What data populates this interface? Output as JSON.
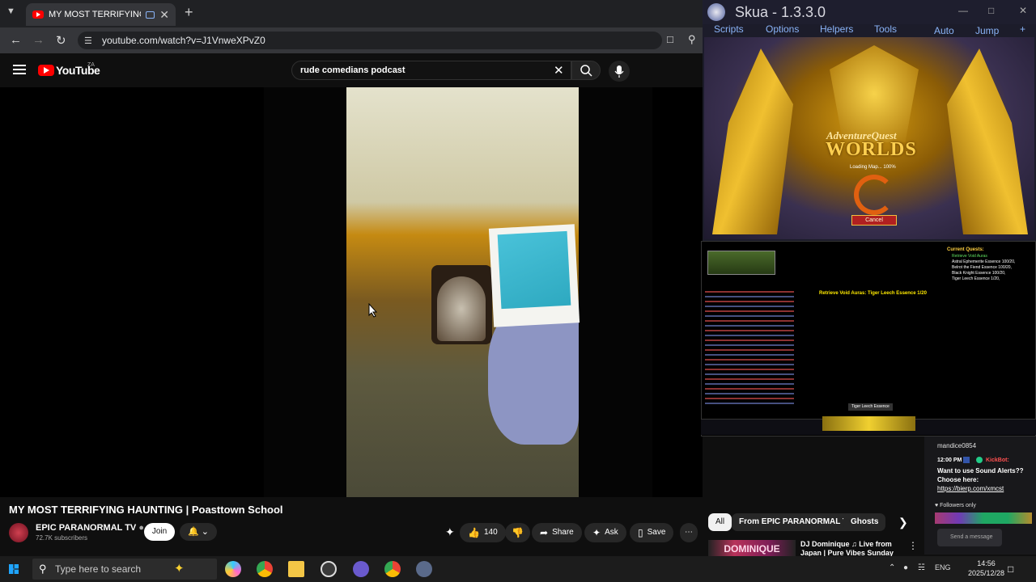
{
  "browser": {
    "tab_title": "MY MOST TERRIFYING HAUNT",
    "url": "youtube.com/watch?v=J1VnweXPvZ0"
  },
  "youtube": {
    "logo_text": "YouTube",
    "region": "ZA",
    "search_query": "rude comedians podcast",
    "video_title": "MY MOST TERRIFYING HAUNTING | Poasttown School",
    "channel_name": "EPIC PARANORMAL TV",
    "subscribers": "72.7K subscribers",
    "join_label": "Join",
    "like_count": "140",
    "share_label": "Share",
    "ask_label": "Ask",
    "save_label": "Save",
    "chips": [
      "All",
      "From EPIC PARANORMAL TV",
      "Ghosts"
    ],
    "rec_thumb_text": "DOMINIQUE",
    "rec_title": "DJ Dominique ♫ Live from Japan | Pure Vibes Sunday"
  },
  "skua": {
    "title": "Skua - 1.3.3.0",
    "menu": [
      "Scripts",
      "Options",
      "Helpers",
      "Tools"
    ],
    "menu_right": [
      "Auto",
      "Jump"
    ],
    "game_logo_top": "AdventureQuest",
    "game_logo": "WORLDS",
    "loading_text": "Loading Map... 100%",
    "cancel_label": "Cancel",
    "quest_title": "Current Quests:",
    "quest_lines": [
      "Retrieve Void Auras",
      "Astral Ephemerite Essence 100/20,",
      "Belrot the Fiend Essence 100/20,",
      "Black Knight Essence 100/20,",
      "Tiger Leech Essence 1/20,"
    ],
    "center_msg": "Retrieve Void Auras: Tiger Leech Essence 1/20",
    "tooltip": "Tiger Leech Essence"
  },
  "chat": {
    "user": "mandice0854",
    "time": "12:00 PM",
    "bot": "KickBot:",
    "lines": [
      "Want to use Sound Alerts??",
      "Choose here:"
    ],
    "link": "https://bierp.com/xmcst",
    "followers": "Followers only",
    "input_placeholder": "Send a message"
  },
  "taskbar": {
    "search_placeholder": "Type here to search",
    "lang": "ENG",
    "time": "14:56",
    "date": "2025/12/28"
  }
}
